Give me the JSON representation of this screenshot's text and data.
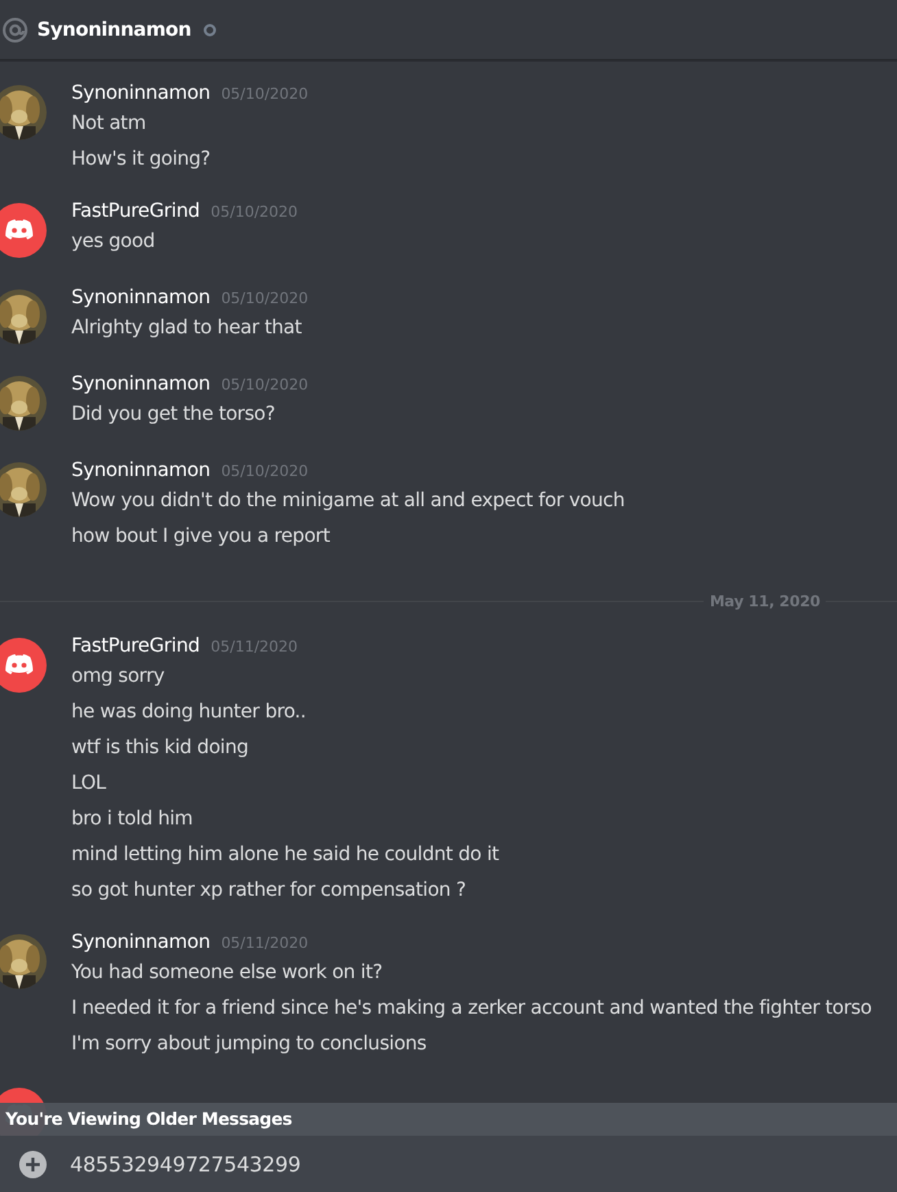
{
  "header": {
    "title": "Synoninnamon"
  },
  "messages": [
    {
      "kind": "group",
      "avatar": {
        "kind": "dog"
      },
      "author": "Synoninnamon",
      "time": "05/10/2020",
      "lines": [
        "Not atm",
        "How's it going?"
      ]
    },
    {
      "kind": "group",
      "avatar": {
        "kind": "discord"
      },
      "author": "FastPureGrind",
      "time": "05/10/2020",
      "lines": [
        "yes good"
      ]
    },
    {
      "kind": "group",
      "avatar": {
        "kind": "dog"
      },
      "author": "Synoninnamon",
      "time": "05/10/2020",
      "lines": [
        "Alrighty glad to hear that"
      ]
    },
    {
      "kind": "group",
      "avatar": {
        "kind": "dog"
      },
      "author": "Synoninnamon",
      "time": "05/10/2020",
      "lines": [
        "Did you get the torso?"
      ]
    },
    {
      "kind": "group",
      "avatar": {
        "kind": "dog"
      },
      "author": "Synoninnamon",
      "time": "05/10/2020",
      "lines": [
        "Wow you didn't do the minigame at all and expect for vouch",
        "how bout I give you a report"
      ]
    },
    {
      "kind": "divider",
      "label": "May 11, 2020"
    },
    {
      "kind": "group",
      "avatar": {
        "kind": "discord"
      },
      "author": "FastPureGrind",
      "time": "05/11/2020",
      "lines": [
        "omg sorry",
        "he was doing hunter bro..",
        "wtf is this kid doing",
        "LOL",
        "bro i told him",
        "mind letting him alone he said he couldnt do it",
        "so got hunter xp rather for compensation ?"
      ]
    },
    {
      "kind": "group",
      "avatar": {
        "kind": "dog"
      },
      "author": "Synoninnamon",
      "time": "05/11/2020",
      "lines": [
        "You had someone else work on it?",
        "I needed it for a friend since he's making a zerker account and wanted the fighter torso",
        "I'm sorry about jumping to conclusions"
      ]
    },
    {
      "kind": "group",
      "avatar": {
        "kind": "discord"
      }
    }
  ],
  "banner": {
    "text": "You're Viewing Older Messages"
  },
  "composer": {
    "value": "485532949727543299"
  }
}
